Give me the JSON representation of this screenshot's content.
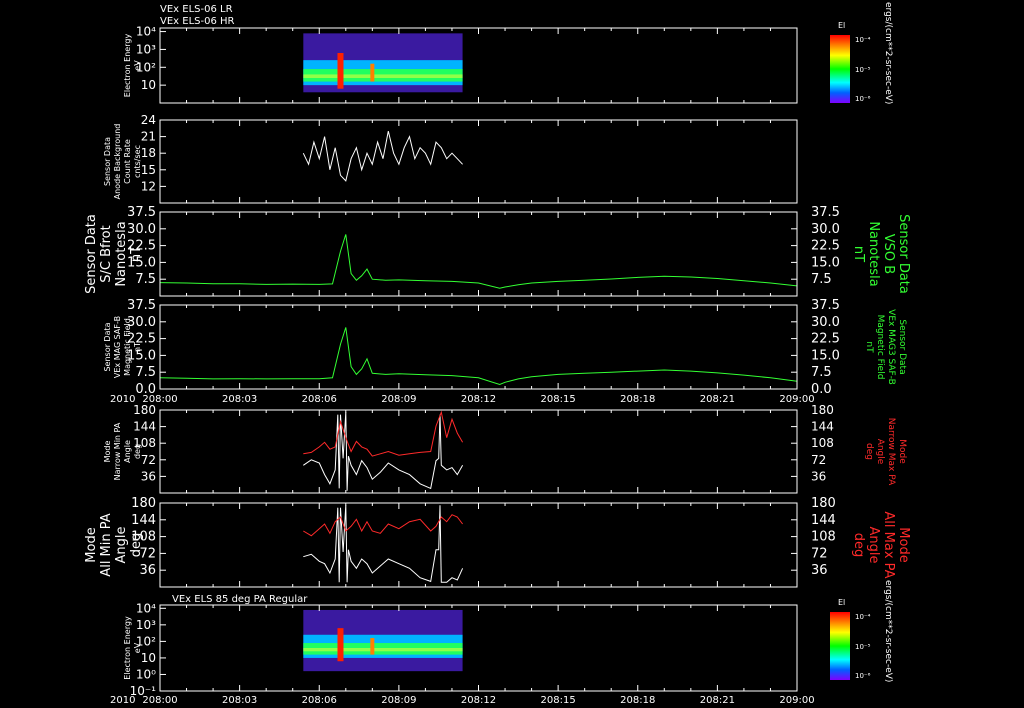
{
  "colors": {
    "background": "#000000",
    "axes": "#ffffff",
    "green": "#33ff33",
    "red": "#ff2a2a",
    "white_trace": "#ffffff"
  },
  "header": {
    "line1": "VEx ELS-06 LR",
    "line2": "VEx ELS-06 HR"
  },
  "time_axis": {
    "year": "2010",
    "ticks": [
      "208:00",
      "208:03",
      "208:06",
      "208:09",
      "208:12",
      "208:15",
      "208:18",
      "208:21",
      "209:00"
    ]
  },
  "colorbar": {
    "title": "El",
    "unit_label": "ergs/(cm**2-sr-sec-eV)",
    "ticks": [
      "10⁻⁴",
      "10⁻⁵",
      "10⁻⁶"
    ]
  },
  "panels": [
    {
      "id": "p1",
      "type": "spectrogram",
      "left_label": [
        "Electron Energy",
        "eV"
      ],
      "yticks": [
        "10⁴",
        "10³",
        "10²",
        "10"
      ],
      "ylog": true,
      "ylim_exp": [
        0,
        4.2
      ]
    },
    {
      "id": "p2",
      "type": "line",
      "left_label": [
        "Sensor Data",
        "Anode Background",
        "Count Rate",
        "cnts/sec"
      ],
      "yticks": [
        "24",
        "21",
        "18",
        "15",
        "12"
      ],
      "ylim": [
        9,
        24
      ]
    },
    {
      "id": "p3",
      "type": "line",
      "left_label": [
        "Sensor Data",
        "S/C Bfrot",
        "Nanotesla",
        "nT"
      ],
      "right_label": [
        "Sensor Data",
        "VSO B",
        "Nanotesla",
        "nT"
      ],
      "yticks": [
        "37.5",
        "30.0",
        "22.5",
        "15.0",
        "7.5"
      ],
      "ylim": [
        0,
        37.5
      ]
    },
    {
      "id": "p4",
      "type": "line",
      "left_label": [
        "Sensor Data",
        "VEx MAG SAF-B",
        "Magnetic Field",
        "nT"
      ],
      "right_label": [
        "Sensor Data",
        "VEx MAG3 SAF-B",
        "Magnetic Field",
        "nT"
      ],
      "yticks": [
        "37.5",
        "30.0",
        "22.5",
        "15.0",
        "7.5",
        "0.0"
      ],
      "ylim": [
        0,
        37.5
      ]
    },
    {
      "id": "p5",
      "type": "line",
      "left_label": [
        "Mode",
        "Narrow Min PA",
        "Angle",
        "deg"
      ],
      "right_label": [
        "Mode",
        "Narrow Max PA",
        "Angle",
        "deg"
      ],
      "yticks": [
        "180",
        "144",
        "108",
        "72",
        "36"
      ],
      "ylim": [
        0,
        180
      ]
    },
    {
      "id": "p6",
      "type": "line",
      "left_label": [
        "Mode",
        "All Min PA",
        "Angle",
        "deg"
      ],
      "right_label": [
        "Mode",
        "All Max PA",
        "Angle",
        "deg"
      ],
      "yticks": [
        "180",
        "144",
        "108",
        "72",
        "36"
      ],
      "ylim": [
        0,
        180
      ]
    },
    {
      "id": "p7",
      "type": "spectrogram",
      "title": "VEx ELS 85 deg PA Regular",
      "left_label": [
        "Electron Energy",
        "eV"
      ],
      "yticks": [
        "10⁴",
        "10³",
        "10²",
        "10",
        "10⁰",
        "10⁻¹"
      ],
      "ylog": true,
      "ylim_exp": [
        -1,
        4.2
      ]
    }
  ],
  "chart_data": [
    {
      "type": "heatmap",
      "title": "VEx ELS-06 LR / VEx ELS-06 HR",
      "ylabel": "Electron Energy eV",
      "y_scale": "log",
      "data_window": [
        "208:05.4",
        "208:11.4"
      ],
      "peak_time": "208:06.8"
    },
    {
      "type": "line",
      "ylabel": "Sensor Data Anode Background Count Rate cnts/sec",
      "ylim": [
        9,
        24
      ],
      "series": [
        {
          "color": "#ffffff",
          "x": [
            5.4,
            5.6,
            5.8,
            6.0,
            6.2,
            6.4,
            6.6,
            6.8,
            7.0,
            7.2,
            7.4,
            7.6,
            7.8,
            8.0,
            8.2,
            8.4,
            8.6,
            8.8,
            9.0,
            9.2,
            9.4,
            9.6,
            9.8,
            10.0,
            10.2,
            10.4,
            10.6,
            10.8,
            11.0,
            11.2,
            11.4
          ],
          "values": [
            18,
            16,
            20,
            17,
            21,
            15,
            19,
            14,
            13,
            17,
            19,
            15,
            18,
            16,
            20,
            17,
            22,
            18,
            16,
            19,
            21,
            17,
            19,
            18,
            16,
            20,
            19,
            17,
            18,
            17,
            16
          ]
        }
      ]
    },
    {
      "type": "line",
      "ylabel": "Sensor Data S/C Bfrot Nanotesla nT",
      "ylim": [
        0,
        37.5
      ],
      "series": [
        {
          "color": "#33ff33",
          "x": [
            0,
            1,
            2,
            3,
            4,
            5,
            6,
            6.5,
            6.8,
            7.0,
            7.2,
            7.4,
            7.6,
            7.8,
            8.0,
            8.5,
            9,
            10,
            11,
            12,
            12.8,
            13,
            13.5,
            14,
            15,
            16,
            17,
            18,
            19,
            20,
            21,
            22,
            23,
            24
          ],
          "values": [
            6,
            5.8,
            5.5,
            5.5,
            5.2,
            5.3,
            5.2,
            5.4,
            20,
            27.5,
            10,
            7,
            9,
            12,
            7.5,
            7,
            7.2,
            6.8,
            6.5,
            5.8,
            3.5,
            4,
            5,
            5.8,
            6.5,
            7,
            7.6,
            8.3,
            8.8,
            8.5,
            7.8,
            6.8,
            5.8,
            4.5
          ]
        }
      ]
    },
    {
      "type": "line",
      "ylabel": "Sensor Data VEx MAG SAF-B Magnetic Field nT",
      "ylim": [
        0,
        37.5
      ],
      "series": [
        {
          "color": "#33ff33",
          "x": [
            0,
            1,
            2,
            3,
            4,
            5,
            6,
            6.5,
            6.8,
            7.0,
            7.2,
            7.4,
            7.6,
            7.8,
            8.0,
            8.5,
            9,
            10,
            11,
            12,
            12.8,
            13,
            13.5,
            14,
            15,
            16,
            17,
            18,
            19,
            20,
            21,
            22,
            23,
            24
          ],
          "values": [
            5,
            4.8,
            4.5,
            4.6,
            4.5,
            4.6,
            4.6,
            5,
            20,
            27.5,
            10,
            6.5,
            9,
            13.5,
            7,
            6.5,
            6.8,
            6.4,
            6,
            5,
            2,
            3,
            4.5,
            5.5,
            6.5,
            7,
            7.5,
            8,
            8.5,
            8,
            7.2,
            6.2,
            5,
            3.5
          ]
        }
      ]
    },
    {
      "type": "line",
      "ylabel": "Mode Narrow Min/Max PA Angle deg",
      "ylim": [
        0,
        180
      ],
      "series": [
        {
          "color": "#ffffff",
          "x": [
            5.4,
            5.7,
            6.0,
            6.2,
            6.4,
            6.6,
            6.7,
            6.75,
            6.8,
            6.9,
            7.0,
            7.05,
            7.1,
            7.2,
            7.4,
            7.6,
            7.8,
            8.0,
            8.3,
            8.6,
            9.0,
            9.4,
            9.8,
            10.2,
            10.4,
            10.5,
            10.55,
            10.6,
            10.8,
            11.0,
            11.2,
            11.4
          ],
          "values": [
            60,
            72,
            65,
            40,
            20,
            50,
            170,
            10,
            170,
            75,
            175,
            5,
            80,
            60,
            40,
            70,
            55,
            30,
            45,
            65,
            50,
            40,
            20,
            10,
            70,
            75,
            170,
            60,
            50,
            55,
            40,
            60
          ]
        },
        {
          "color": "#ff2a2a",
          "x": [
            5.4,
            5.7,
            6.0,
            6.2,
            6.4,
            6.6,
            6.8,
            7.0,
            7.2,
            7.4,
            7.6,
            7.8,
            8.0,
            8.3,
            8.6,
            9.0,
            9.4,
            9.8,
            10.2,
            10.4,
            10.6,
            10.8,
            11.0,
            11.2,
            11.4
          ],
          "values": [
            85,
            88,
            100,
            110,
            95,
            100,
            155,
            120,
            90,
            112,
            100,
            95,
            80,
            85,
            90,
            82,
            85,
            88,
            90,
            145,
            175,
            120,
            160,
            130,
            110
          ]
        }
      ]
    },
    {
      "type": "line",
      "ylabel": "Mode All Min/Max PA Angle deg",
      "ylim": [
        0,
        180
      ],
      "series": [
        {
          "color": "#ffffff",
          "x": [
            5.4,
            5.7,
            6.0,
            6.2,
            6.4,
            6.6,
            6.7,
            6.75,
            6.8,
            6.9,
            7.0,
            7.05,
            7.1,
            7.2,
            7.4,
            7.6,
            7.8,
            8.0,
            8.3,
            8.6,
            9.0,
            9.4,
            9.8,
            10.2,
            10.4,
            10.5,
            10.55,
            10.6,
            10.8,
            11.0,
            11.2,
            11.4
          ],
          "values": [
            65,
            70,
            55,
            50,
            30,
            60,
            170,
            10,
            170,
            75,
            175,
            10,
            80,
            55,
            40,
            60,
            50,
            30,
            45,
            60,
            50,
            40,
            20,
            12,
            80,
            80,
            175,
            10,
            10,
            20,
            15,
            40
          ]
        },
        {
          "color": "#ff2a2a",
          "x": [
            5.4,
            5.7,
            6.0,
            6.2,
            6.4,
            6.6,
            6.8,
            7.0,
            7.2,
            7.4,
            7.6,
            7.8,
            8.0,
            8.3,
            8.6,
            9.0,
            9.4,
            9.8,
            10.2,
            10.4,
            10.6,
            10.8,
            11.0,
            11.2,
            11.4
          ],
          "values": [
            120,
            110,
            125,
            135,
            115,
            140,
            150,
            120,
            130,
            145,
            120,
            140,
            120,
            115,
            135,
            125,
            140,
            145,
            120,
            130,
            150,
            140,
            155,
            150,
            135
          ]
        }
      ]
    },
    {
      "type": "heatmap",
      "title": "VEx ELS 85 deg PA Regular",
      "ylabel": "Electron Energy eV",
      "y_scale": "log",
      "data_window": [
        "208:05.4",
        "208:11.4"
      ],
      "peak_time": "208:06.8"
    }
  ]
}
